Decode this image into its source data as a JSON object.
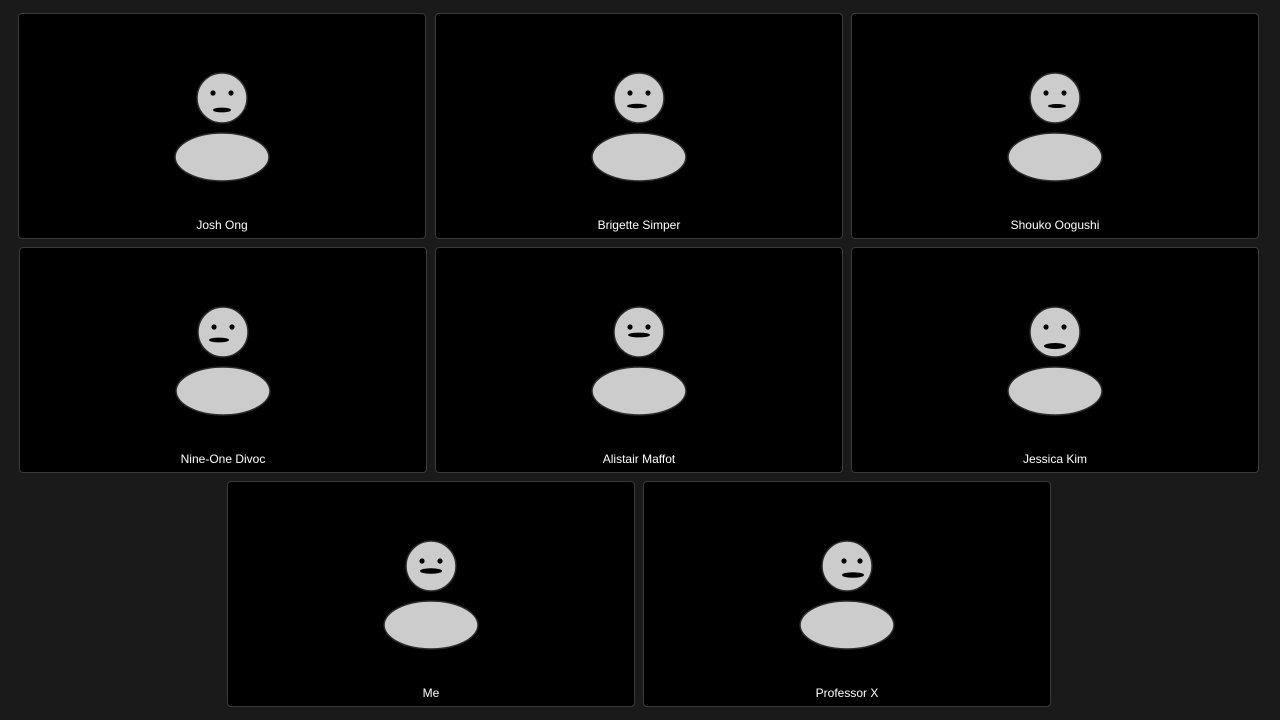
{
  "meeting": {
    "participants": [
      {
        "name": "Josh Ong",
        "avatar_icon": "person-avatar-icon"
      },
      {
        "name": "Brigette Simper",
        "avatar_icon": "person-avatar-icon"
      },
      {
        "name": "Shouko Oogushi",
        "avatar_icon": "person-avatar-icon"
      },
      {
        "name": "Nine-One Divoc",
        "avatar_icon": "person-avatar-icon"
      },
      {
        "name": "Alistair Maffot",
        "avatar_icon": "person-avatar-icon"
      },
      {
        "name": "Jessica Kim",
        "avatar_icon": "person-avatar-icon"
      },
      {
        "name": "Me",
        "avatar_icon": "person-avatar-icon"
      },
      {
        "name": "Professor X",
        "avatar_icon": "person-avatar-icon"
      }
    ]
  },
  "colors": {
    "background": "#1a1a1a",
    "tile_background": "#000000",
    "tile_border": "#3a3a3a",
    "avatar_fill": "#cccccc",
    "name_text": "#ffffff"
  }
}
